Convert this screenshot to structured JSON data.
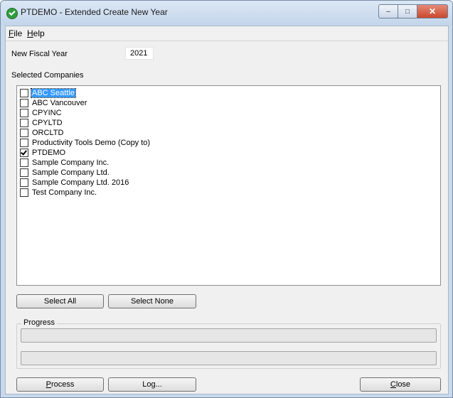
{
  "window": {
    "title": "PTDEMO - Extended Create New Year",
    "caption_buttons": {
      "minimize": "–",
      "maximize": "□",
      "close": "✕"
    }
  },
  "menu": [
    {
      "label": "File",
      "mnemonic": "F",
      "rest": "ile"
    },
    {
      "label": "Help",
      "mnemonic": "H",
      "rest": "elp"
    }
  ],
  "fiscal_year": {
    "label": "New Fiscal Year",
    "value": "2021"
  },
  "companies": {
    "label": "Selected Companies",
    "items": [
      {
        "name": "ABC Seattle",
        "checked": false,
        "selected": true
      },
      {
        "name": "ABC Vancouver",
        "checked": false,
        "selected": false
      },
      {
        "name": "CPYINC",
        "checked": false,
        "selected": false
      },
      {
        "name": "CPYLTD",
        "checked": false,
        "selected": false
      },
      {
        "name": "ORCLTD",
        "checked": false,
        "selected": false
      },
      {
        "name": "Productivity Tools Demo (Copy to)",
        "checked": false,
        "selected": false
      },
      {
        "name": "PTDEMO",
        "checked": true,
        "selected": false
      },
      {
        "name": "Sample Company Inc.",
        "checked": false,
        "selected": false
      },
      {
        "name": "Sample Company Ltd.",
        "checked": false,
        "selected": false
      },
      {
        "name": "Sample Company Ltd. 2016",
        "checked": false,
        "selected": false
      },
      {
        "name": "Test Company Inc.",
        "checked": false,
        "selected": false
      }
    ]
  },
  "buttons": {
    "select_all": "Select All",
    "select_none": "Select None",
    "process": {
      "mnemonic": "P",
      "rest": "rocess"
    },
    "log": "Log...",
    "close": {
      "mnemonic": "C",
      "rest": "lose"
    }
  },
  "progress": {
    "label": "Progress",
    "bar1_fraction": 0,
    "bar2_fraction": 0
  }
}
